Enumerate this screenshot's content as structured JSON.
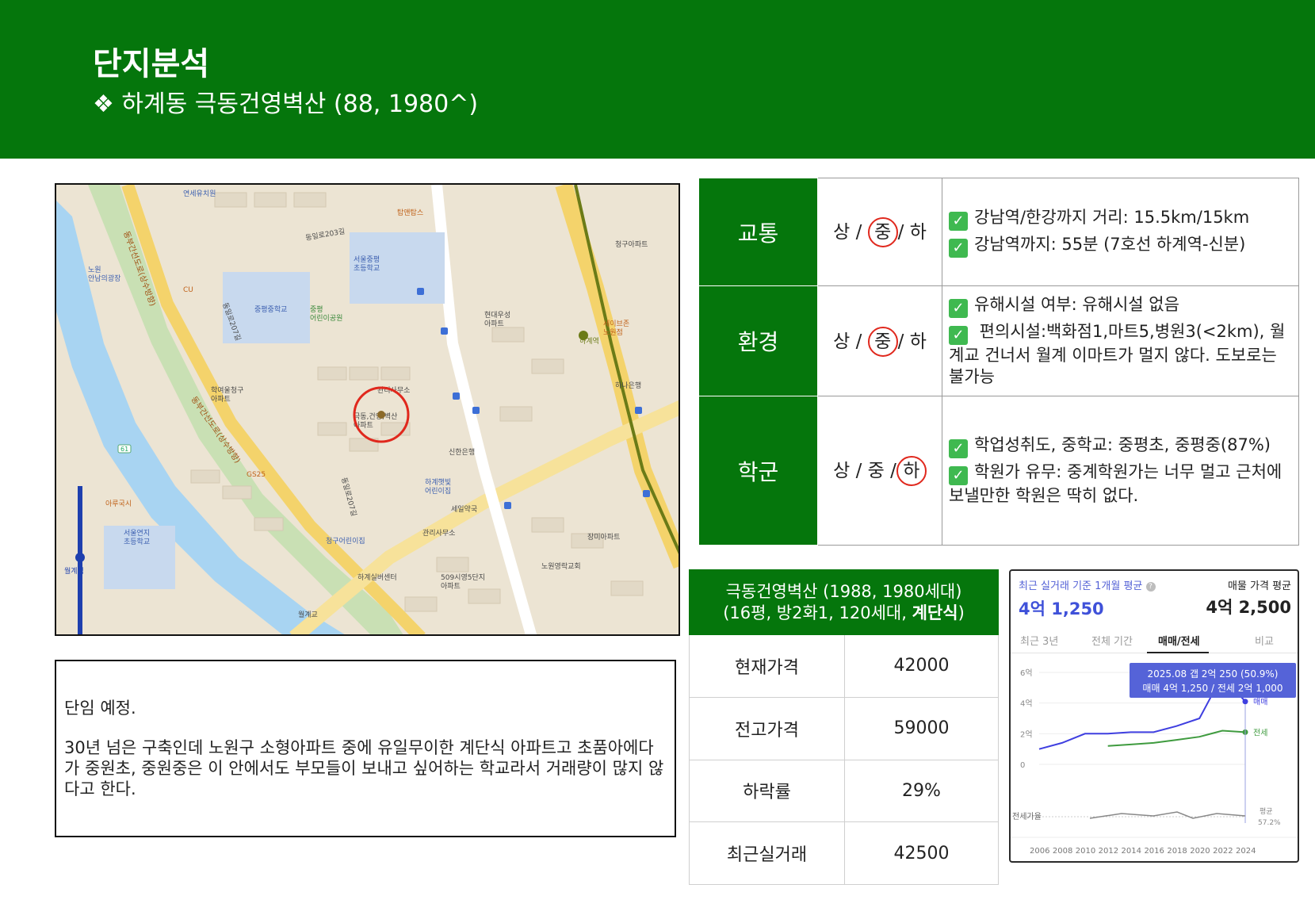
{
  "header": {
    "title": "단지분석",
    "subtitle": "❖ 하계동 극동건영벽산 (88, 1980^)"
  },
  "map": {
    "labels": {
      "yeonse": "연세유치원",
      "tapen": "탑앤탑스",
      "nowon_plaza": "노원\n안남의광장",
      "cu": "CU",
      "junggye_mid": "중평중학교",
      "seoul_elem": "서울중평\n초등학교",
      "junggye_park": "중평\n어린이공원",
      "hyundai": "현대우성\n아파트",
      "hakyeoul": "학여울청구\n아파트",
      "target": "극동,건영,벽산\n아파트",
      "office": "관리사무소",
      "shinhan": "신한은행",
      "hagye_kids": "하계햇빛\n어린이집",
      "seil": "세일약국",
      "cheonggu_kids": "청구어린이집",
      "office2": "관리사무소",
      "hagye_silver": "하계실버센터",
      "siyoung": "509시영5단지\n아파트",
      "nowon_church": "노원영락교회",
      "jangmi": "장미아파트",
      "hana": "하나은행",
      "seoul_yeonji": "서울연지\n초등학교",
      "arugusi": "아루국시",
      "wolgye_st": "월계역",
      "hagye_st": "하계역",
      "hagye_church": "세이브존\n노원점",
      "cheonggu_apt": "청구아파트",
      "dongbu_road1": "동부간선도로(상수방향)",
      "dongbu_road2": "동부간선도로(상수방향)",
      "road_207": "동일로207길",
      "road_203": "동일로203길",
      "road_207b": "동일로207길",
      "gs25": "GS25",
      "wolgye_bridge": "월계교"
    },
    "bus_route": "61"
  },
  "memo": {
    "line1": "단임 예정.",
    "line2": "30년 넘은 구축인데 노원구 소형아파트 중에 유일무이한 계단식 아파트고 초품아에다가 중원초, 중원중은 이 안에서도 부모들이 보내고 싶어하는 학교라서 거래량이 많지 않다고 한다."
  },
  "analysis": {
    "rows": [
      {
        "category": "교통",
        "grades": [
          "상",
          "중",
          "하"
        ],
        "selected": 1,
        "items": [
          "강남역/한강까지 거리: 15.5km/15km",
          "강남역까지: 55분 (7호선 하계역-신분)"
        ]
      },
      {
        "category": "환경",
        "grades": [
          "상",
          "중",
          "하"
        ],
        "selected": 1,
        "items": [
          "유해시설 여부: 유해시설 없음",
          " 편의시설:백화점1,마트5,병원3(<2km), 월계교 건너서 월계 이마트가 멀지 않다. 도보로는 불가능"
        ]
      },
      {
        "category": "학군",
        "grades": [
          "상",
          "중",
          "하"
        ],
        "selected": 2,
        "items": [
          "학업성취도, 중학교: 중평초, 중평중(87%)",
          "학원가 유무: 중계학원가는 너무 멀고 근처에 보낼만한 학원은 딱히 없다."
        ]
      }
    ]
  },
  "price": {
    "header_line1": "극동건영벽산 (1988, 1980세대)",
    "header_line2_pre": "(16평, 방2화1, 120세대, ",
    "header_line2_bold": "계단식",
    "header_line2_post": ")",
    "rows": [
      {
        "label": "현재가격",
        "value": "42000"
      },
      {
        "label": "전고가격",
        "value": "59000"
      },
      {
        "label": "하락률",
        "value": "29%"
      },
      {
        "label": "최근실거래",
        "value": "42500"
      }
    ]
  },
  "widget": {
    "recent_label": "최근 실거래 기준 1개월 평균",
    "recent_value": "4억 1,250",
    "listing_label": "매물 가격 평균",
    "listing_value": "4억 2,500",
    "tabs": [
      "최근 3년",
      "전체 기간",
      "매매/전세",
      "비교"
    ],
    "active_tab": 2,
    "tooltip_line1": "2025.08 갭 2억 250 (50.9%)",
    "tooltip_line2": "매매 4억 1,250 / 전세 2억 1,000",
    "colors": {
      "sale": "#3f3fe0",
      "jeonse": "#3f9b3f",
      "ratio": "#888888"
    },
    "chart_data": {
      "type": "line",
      "y_ticks": [
        "6억",
        "4억",
        "2억",
        "0"
      ],
      "ylim": [
        0,
        6
      ],
      "x": [
        "2006",
        "2008",
        "2010",
        "2012",
        "2014",
        "2016",
        "2018",
        "2020",
        "2022",
        "2024"
      ],
      "series": [
        {
          "name": "매매",
          "values": [
            1.0,
            1.4,
            2.0,
            2.0,
            2.1,
            2.1,
            2.5,
            3.0,
            5.8,
            4.1
          ]
        },
        {
          "name": "전세",
          "values": [
            null,
            null,
            null,
            1.2,
            1.3,
            1.4,
            1.6,
            1.8,
            2.2,
            2.1
          ]
        }
      ],
      "ratio_label": "전세가율",
      "ratio_avg_label": "평균",
      "ratio_avg_value": "57.2%"
    }
  }
}
